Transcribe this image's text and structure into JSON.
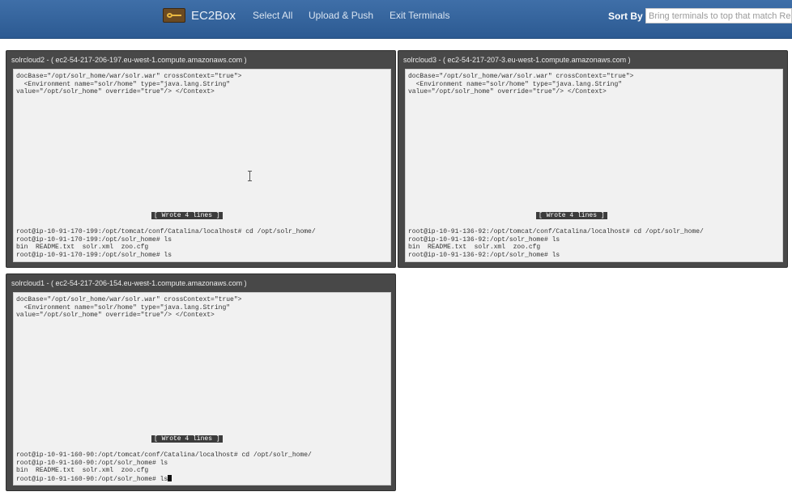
{
  "navbar": {
    "brand": "EC2Box",
    "select_all": "Select All",
    "upload_push": "Upload & Push",
    "exit_terminals": "Exit Terminals",
    "sort_by": "Sort By",
    "sort_placeholder": "Bring terminals to top that match Re"
  },
  "terminals": [
    {
      "title": "solrcloud2 - ( ec2-54-217-206-197.eu-west-1.compute.amazonaws.com )",
      "top_lines": [
        "docBase=\"/opt/solr_home/war/solr.war\" crossContext=\"true\">",
        "  <Environment name=\"solr/home\" type=\"java.lang.String\"",
        "value=\"/opt/solr_home\" override=\"true\"/> </Context>"
      ],
      "status": "[ Wrote 4 lines ]",
      "bottom_lines": [
        "root@ip-10-91-170-199:/opt/tomcat/conf/Catalina/localhost# cd /opt/solr_home/",
        "root@ip-10-91-170-199:/opt/solr_home# ls",
        "bin  README.txt  solr.xml  zoo.cfg",
        "root@ip-10-91-170-199:/opt/solr_home# ls"
      ]
    },
    {
      "title": "solrcloud3 - ( ec2-54-217-207-3.eu-west-1.compute.amazonaws.com )",
      "top_lines": [
        "docBase=\"/opt/solr_home/war/solr.war\" crossContext=\"true\">",
        "  <Environment name=\"solr/home\" type=\"java.lang.String\"",
        "value=\"/opt/solr_home\" override=\"true\"/> </Context>"
      ],
      "status": "[ Wrote 4 lines ]",
      "bottom_lines": [
        "root@ip-10-91-136-92:/opt/tomcat/conf/Catalina/localhost# cd /opt/solr_home/",
        "root@ip-10-91-136-92:/opt/solr_home# ls",
        "bin  README.txt  solr.xml  zoo.cfg",
        "root@ip-10-91-136-92:/opt/solr_home# ls"
      ]
    },
    {
      "title": "solrcloud1 - ( ec2-54-217-206-154.eu-west-1.compute.amazonaws.com )",
      "top_lines": [
        "docBase=\"/opt/solr_home/war/solr.war\" crossContext=\"true\">",
        "  <Environment name=\"solr/home\" type=\"java.lang.String\"",
        "value=\"/opt/solr_home\" override=\"true\"/> </Context>"
      ],
      "status": "[ Wrote 4 lines ]",
      "bottom_lines": [
        "root@ip-10-91-160-90:/opt/tomcat/conf/Catalina/localhost# cd /opt/solr_home/",
        "root@ip-10-91-160-90:/opt/solr_home# ls",
        "bin  README.txt  solr.xml  zoo.cfg",
        "root@ip-10-91-160-90:/opt/solr_home# ls"
      ]
    }
  ]
}
